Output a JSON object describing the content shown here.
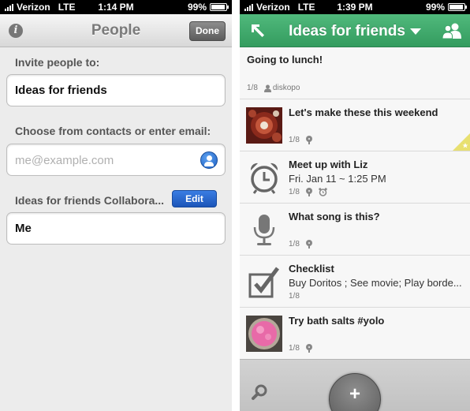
{
  "left": {
    "status": {
      "carrier": "Verizon",
      "network": "LTE",
      "time": "1:14 PM",
      "battery": "99%"
    },
    "header": {
      "info_icon": "info-icon",
      "title": "People",
      "done_label": "Done"
    },
    "invite_label": "Invite people to:",
    "invite_value": "Ideas for friends",
    "contacts_label": "Choose from contacts or enter email:",
    "email_placeholder": "me@example.com",
    "contact_icon": "contact-picker-icon",
    "collaborators_label": "Ideas for friends Collabora...",
    "edit_label": "Edit",
    "collaborator": "Me"
  },
  "right": {
    "status": {
      "carrier": "Verizon",
      "network": "LTE",
      "time": "1:39 PM",
      "battery": "99%"
    },
    "header": {
      "title": "Ideas for friends",
      "back_icon": "collapse-arrow-icon",
      "people_icon": "people-icon"
    },
    "notes": [
      {
        "title": "Going to lunch!",
        "count": "1/8",
        "author": "diskopo",
        "icon": "none"
      },
      {
        "title": "Let's make these this weekend",
        "count": "1/8",
        "icon": "food-photo-thumbnail"
      },
      {
        "title": "Meet up with Liz",
        "subtitle": "Fri. Jan 11 ~ 1:25 PM",
        "count": "1/8",
        "icon": "alarm-clock-icon"
      },
      {
        "title": "What song is this?",
        "count": "1/8",
        "icon": "microphone-icon"
      },
      {
        "title": "Checklist",
        "subtitle": "Buy Doritos ; See movie; Play borde...",
        "count": "1/8",
        "icon": "checkbox-icon"
      },
      {
        "title": "Try bath salts #yolo",
        "count": "1/8",
        "icon": "pink-photo-thumbnail"
      }
    ],
    "bottom": {
      "search_icon": "search-icon",
      "add_label": "+"
    }
  },
  "colors": {
    "green_header": "#42ab6e",
    "edit_blue": "#2563c9",
    "panel_gray": "#ececec"
  }
}
